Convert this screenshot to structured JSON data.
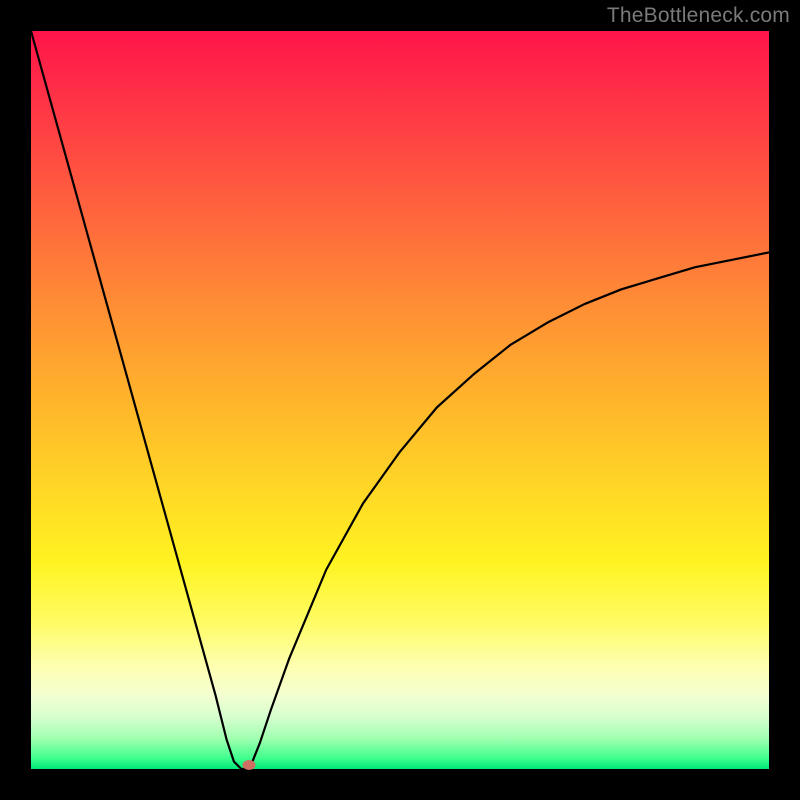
{
  "watermark": "TheBottleneck.com",
  "colors": {
    "frame": "#000000",
    "curve_stroke": "#000000",
    "marker_fill": "#cf6f63",
    "watermark_text": "#7a7a7a"
  },
  "chart_data": {
    "type": "line",
    "title": "",
    "xlabel": "",
    "ylabel": "",
    "xlim": [
      0,
      100
    ],
    "ylim": [
      0,
      100
    ],
    "grid": false,
    "legend": null,
    "series": [
      {
        "name": "bottleneck-curve",
        "x": [
          0,
          2.5,
          5,
          7.5,
          10,
          12.5,
          15,
          17.5,
          20,
          22.5,
          25,
          26.5,
          27.5,
          28.5,
          29.5,
          30,
          31,
          32.5,
          35,
          37.5,
          40,
          45,
          50,
          55,
          60,
          65,
          70,
          75,
          80,
          85,
          90,
          95,
          100
        ],
        "values": [
          100,
          91,
          82,
          73,
          64,
          55,
          46,
          37,
          28,
          19,
          10,
          4,
          1,
          0,
          0,
          1,
          3.5,
          8,
          15,
          21,
          27,
          36,
          43,
          49,
          53.5,
          57.5,
          60.5,
          63,
          65,
          66.5,
          68,
          69,
          70
        ]
      }
    ],
    "annotations": [
      {
        "type": "point",
        "name": "minimum-marker",
        "x": 29.6,
        "y": 0.6
      }
    ],
    "background_gradient": {
      "direction": "vertical",
      "stops": [
        {
          "pos": 0.0,
          "color": "#ff1449"
        },
        {
          "pos": 0.36,
          "color": "#ff8a36"
        },
        {
          "pos": 0.62,
          "color": "#ffd726"
        },
        {
          "pos": 0.86,
          "color": "#feffb0"
        },
        {
          "pos": 1.0,
          "color": "#00e878"
        }
      ]
    }
  }
}
